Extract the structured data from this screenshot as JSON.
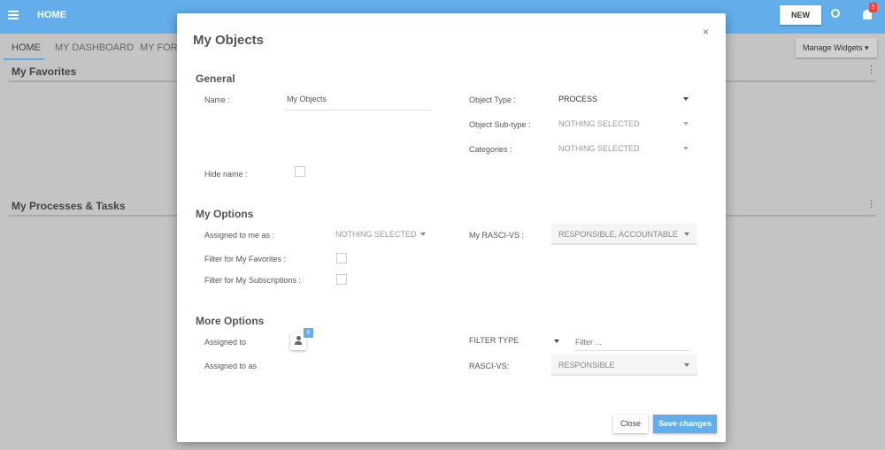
{
  "header": {
    "title": "HOME",
    "new_label": "NEW",
    "notifications": "5"
  },
  "tabs": [
    "HOME",
    "MY DASHBOARD",
    "MY FORMS"
  ],
  "manage_widgets": "Manage Widgets",
  "panels": [
    "My Favorites",
    "My Processes & Tasks"
  ],
  "modal": {
    "title": "My Objects",
    "close_x": "×",
    "general": {
      "heading": "General",
      "name_label": "Name :",
      "name_value": "My Objects",
      "object_type_label": "Object Type :",
      "object_type_value": "PROCESS",
      "sub_type_label": "Object Sub-type :",
      "sub_type_value": "NOTHING SELECTED",
      "categories_label": "Categories :",
      "categories_value": "NOTHING SELECTED",
      "hide_name_label": "Hide name :"
    },
    "my_options": {
      "heading": "My Options",
      "assigned_label": "Assigned to me as :",
      "assigned_value": "NOTHING SELECTED",
      "rasci_label": "My RASCI-VS :",
      "rasci_value": "RESPONSIBLE, ACCOUNTABLE",
      "fav_label": "Filter for My Favorites :",
      "subs_label": "Filter for My Subscriptions :"
    },
    "more_options": {
      "heading": "More Options",
      "assigned_to_label": "Assigned to",
      "assigned_count": "0",
      "assigned_as_label": "Assigned to as",
      "filter_type_label": "FILTER TYPE",
      "filter_placeholder": "Filter ...",
      "rasci_label": "RASCI-VS:",
      "rasci_value": "RESPONSIBLE"
    },
    "close_label": "Close",
    "save_label": "Save changes"
  },
  "colors": {
    "accent": "#63aeea",
    "badge": "#f44336"
  }
}
